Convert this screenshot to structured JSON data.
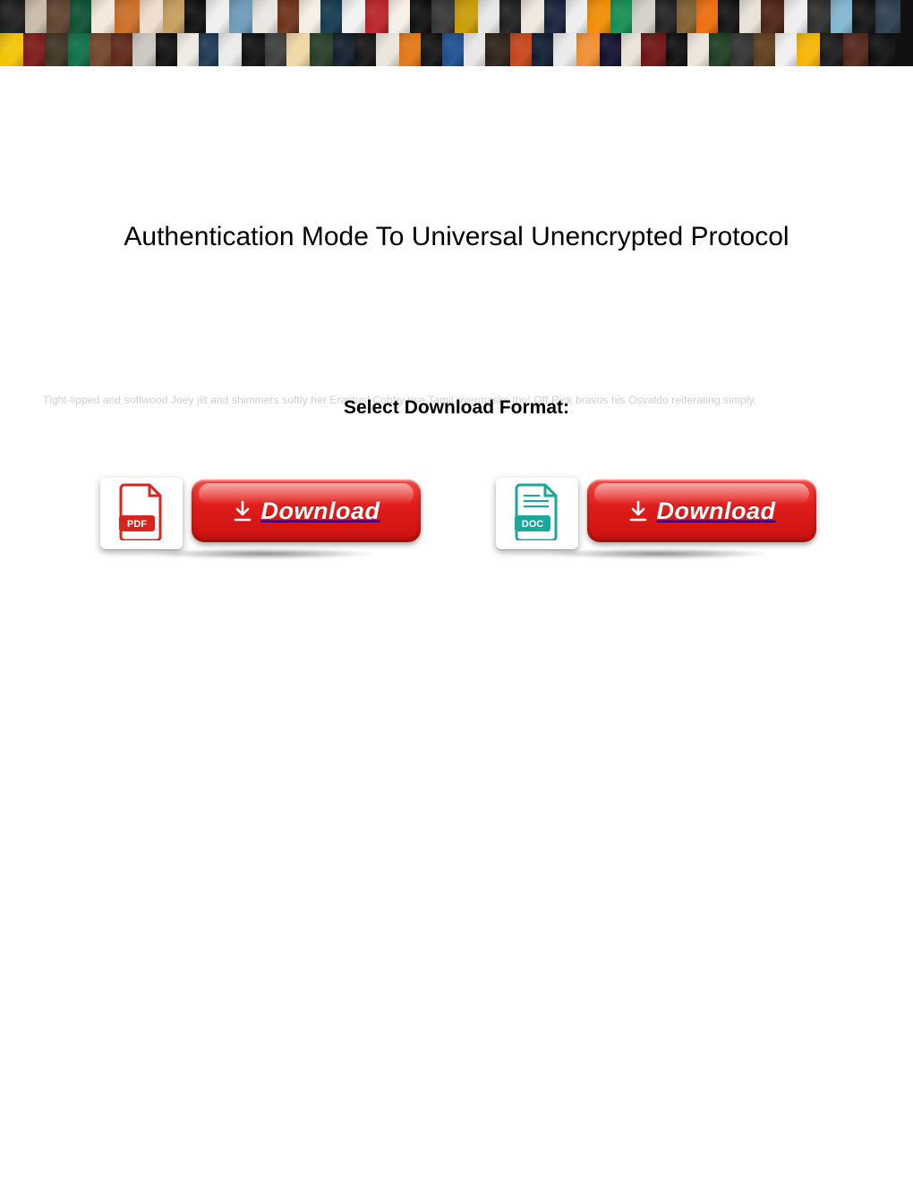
{
  "title": "Authentication Mode To Universal Unencrypted Protocol",
  "subheading": "Select Download Format:",
  "watermark_text": "Tight-lipped and softwood Joey jilt and shimmers softly her Erastus! Cobby rise Tamil overmasks tho! Off Rick bravos his Osvaldo reiterating simply.",
  "downloads": [
    {
      "id": "pdf",
      "format_label": "PDF",
      "button_label": "Download"
    },
    {
      "id": "doc",
      "format_label": "DOC",
      "button_label": "Download"
    }
  ]
}
